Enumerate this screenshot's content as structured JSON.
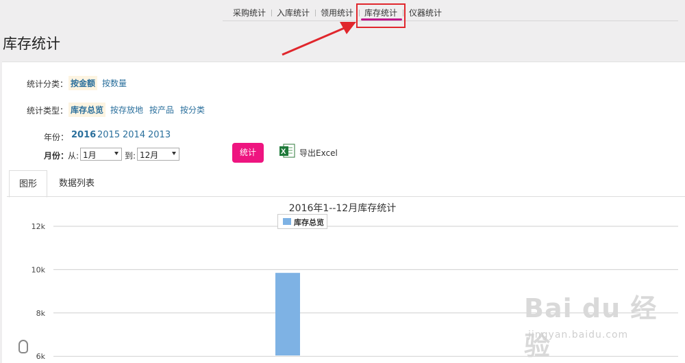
{
  "nav": {
    "items": [
      "采购统计",
      "入库统计",
      "领用统计",
      "库存统计",
      "仪器统计"
    ],
    "active_index": 3
  },
  "page_title": "库存统计",
  "filters": {
    "category_label": "统计分类：",
    "category_options": [
      "按金额",
      "按数量"
    ],
    "category_selected": 0,
    "type_label": "统计类型：",
    "type_options": [
      "库存总览",
      "按存放地",
      "按产品",
      "按分类"
    ],
    "type_selected": 0,
    "year_label": "年份：",
    "years": [
      "2016",
      "2015",
      "2014",
      "2013"
    ],
    "year_selected": 0,
    "month_label": "月份：",
    "from_label": "从:",
    "from_value": "1月",
    "to_label": "到:",
    "to_value": "12月"
  },
  "actions": {
    "stat_label": "统计",
    "export_label": "导出Excel"
  },
  "tabs": [
    "图形",
    "数据列表"
  ],
  "active_tab": 0,
  "watermark": {
    "brand": "Bai du 经验",
    "url": "jingyan.baidu.com"
  },
  "colors": {
    "accent": "#ee1580",
    "bar": "#7eb2e4",
    "link": "#2a6f9c",
    "highlight": "#e0262c"
  },
  "chart_data": {
    "type": "bar",
    "title": "2016年1--12月库存统计",
    "series": [
      {
        "name": "库存总览",
        "values": [
          9850
        ]
      }
    ],
    "categories": [
      ""
    ],
    "y_ticks": [
      "12k",
      "10k",
      "8k",
      "6k"
    ],
    "ylim": [
      6000,
      12000
    ],
    "grid": true,
    "legend": "top-center"
  }
}
